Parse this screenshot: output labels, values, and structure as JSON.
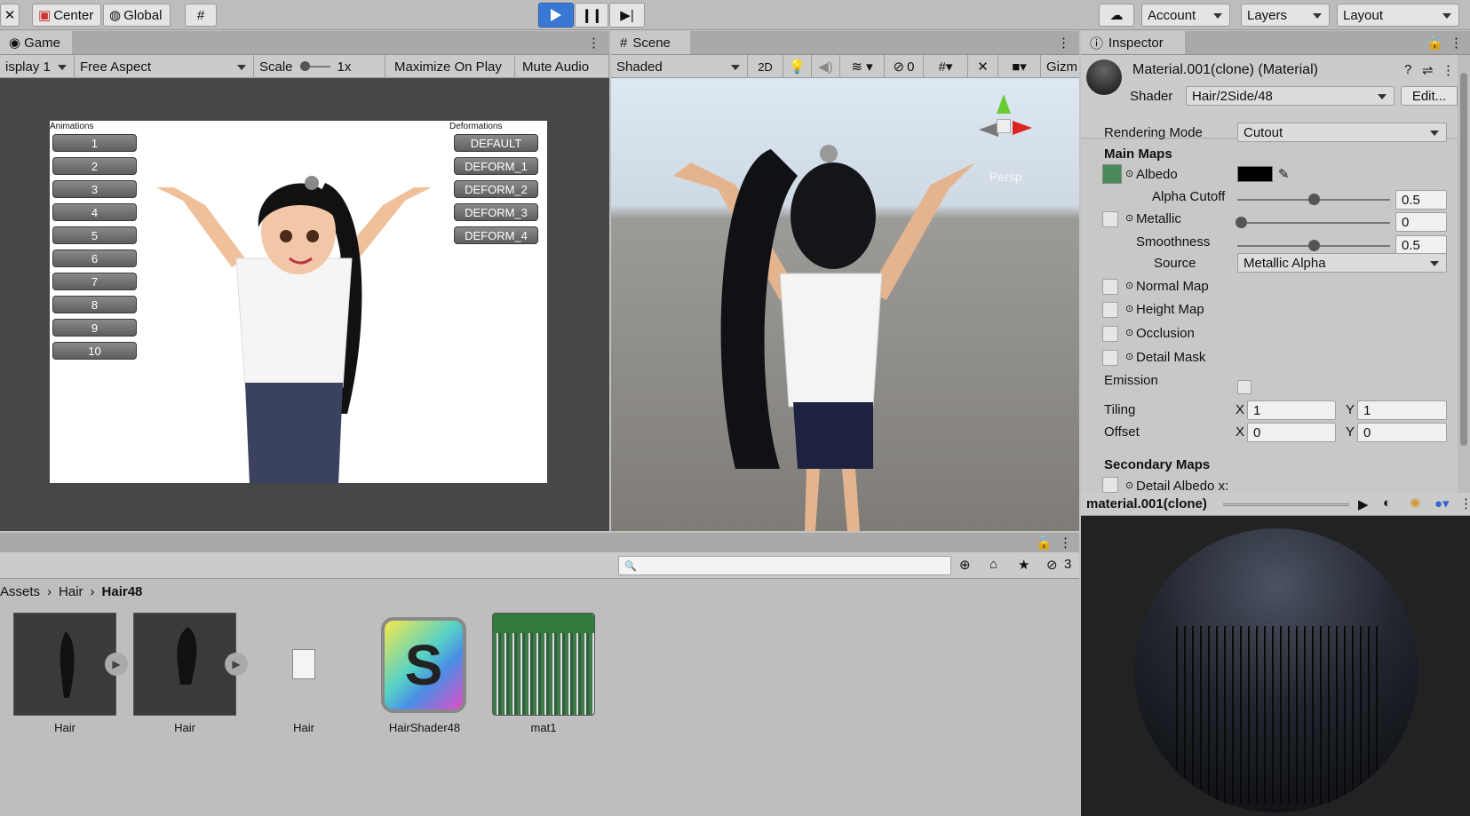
{
  "toolbar": {
    "center_label": "Center",
    "global_label": "Global",
    "account_label": "Account",
    "layers_label": "Layers",
    "layout_label": "Layout"
  },
  "game": {
    "tab": "Game",
    "display": "isplay 1",
    "aspect": "Free Aspect",
    "scale_label": "Scale",
    "scale_value": "1x",
    "maximize": "Maximize On Play",
    "mute": "Mute Audio",
    "animations_label": "Animations",
    "deformations_label": "Deformations",
    "animation_buttons": [
      "1",
      "2",
      "3",
      "4",
      "5",
      "6",
      "7",
      "8",
      "9",
      "10"
    ],
    "deform_buttons": [
      "DEFAULT",
      "DEFORM_1",
      "DEFORM_2",
      "DEFORM_3",
      "DEFORM_4"
    ]
  },
  "scene": {
    "tab": "Scene",
    "shading": "Shaded",
    "mode_2d": "2D",
    "hidden_count": "0",
    "gizmos": "Gizm",
    "persp": "Persp"
  },
  "inspector": {
    "tab": "Inspector",
    "title": "Material.001(clone) (Material)",
    "shader_label": "Shader",
    "shader_value": "Hair/2Side/48",
    "edit_button": "Edit...",
    "rendering_mode_label": "Rendering Mode",
    "rendering_mode_value": "Cutout",
    "main_maps": "Main Maps",
    "albedo": "Albedo",
    "alpha_cutoff": "Alpha Cutoff",
    "alpha_cutoff_value": "0.5",
    "metallic": "Metallic",
    "metallic_value": "0",
    "smoothness": "Smoothness",
    "smoothness_value": "0.5",
    "source_label": "Source",
    "source_value": "Metallic Alpha",
    "normal_map": "Normal Map",
    "height_map": "Height Map",
    "occlusion": "Occlusion",
    "detail_mask": "Detail Mask",
    "emission": "Emission",
    "tiling": "Tiling",
    "offset": "Offset",
    "x_label": "X",
    "y_label": "Y",
    "tiling_x": "1",
    "tiling_y": "1",
    "offset_x": "0",
    "offset_y": "0",
    "secondary_maps": "Secondary Maps",
    "detail_albedo": "Detail Albedo x:",
    "preview_title": "material.001(clone)"
  },
  "project": {
    "breadcrumb": [
      "Assets",
      "Hair",
      "Hair48"
    ],
    "hidden_count": "3",
    "assets": [
      "Hair",
      "Hair",
      "Hair",
      "HairShader48",
      "mat1"
    ],
    "shader_letter": "S"
  },
  "colors": {
    "play_blue": "#3a78d6",
    "albedo_swatch": "#000000"
  }
}
